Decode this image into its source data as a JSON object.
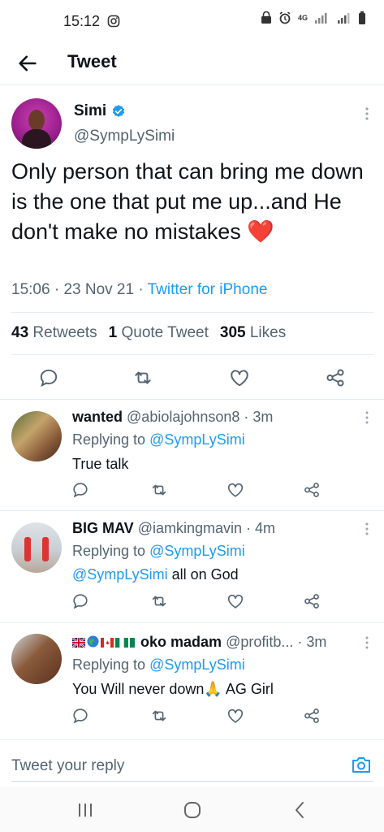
{
  "status_bar": {
    "time": "15:12",
    "network": "4G"
  },
  "header": {
    "title": "Tweet"
  },
  "tweet": {
    "name": "Simi",
    "handle": "@SympLySimi",
    "text": "Only person that can bring me down is the one that put me up...and He don't make no mistakes",
    "emoji": "❤️",
    "time": "15:06",
    "date": "23 Nov 21",
    "source": "Twitter for iPhone",
    "retweets_count": "43",
    "retweets_label": "Retweets",
    "quotes_count": "1",
    "quotes_label": "Quote Tweet",
    "likes_count": "305",
    "likes_label": "Likes"
  },
  "replies": [
    {
      "name": "wanted",
      "handle": "@abiolajohnson8",
      "age": "3m",
      "replying_label": "Replying to",
      "replying_to": "@SympLySimi",
      "text": "True talk"
    },
    {
      "name": "BIG MAV",
      "handle": "@iamkingmavin",
      "age": "4m",
      "replying_label": "Replying to",
      "replying_to": "@SympLySimi",
      "mention": "@SympLySimi",
      "text": " all on God"
    },
    {
      "name": "oko madam",
      "handle": "@profitb...",
      "age": "3m",
      "replying_label": "Replying to",
      "replying_to": "@SympLySimi",
      "text": "You Will never down",
      "emoji": "🙏",
      "text_after": " AG Girl"
    }
  ],
  "reply_bar": {
    "placeholder": "Tweet your reply"
  },
  "colors": {
    "accent": "#1d9bf0",
    "heart": "#e0245e",
    "secondary_text": "#536471"
  }
}
